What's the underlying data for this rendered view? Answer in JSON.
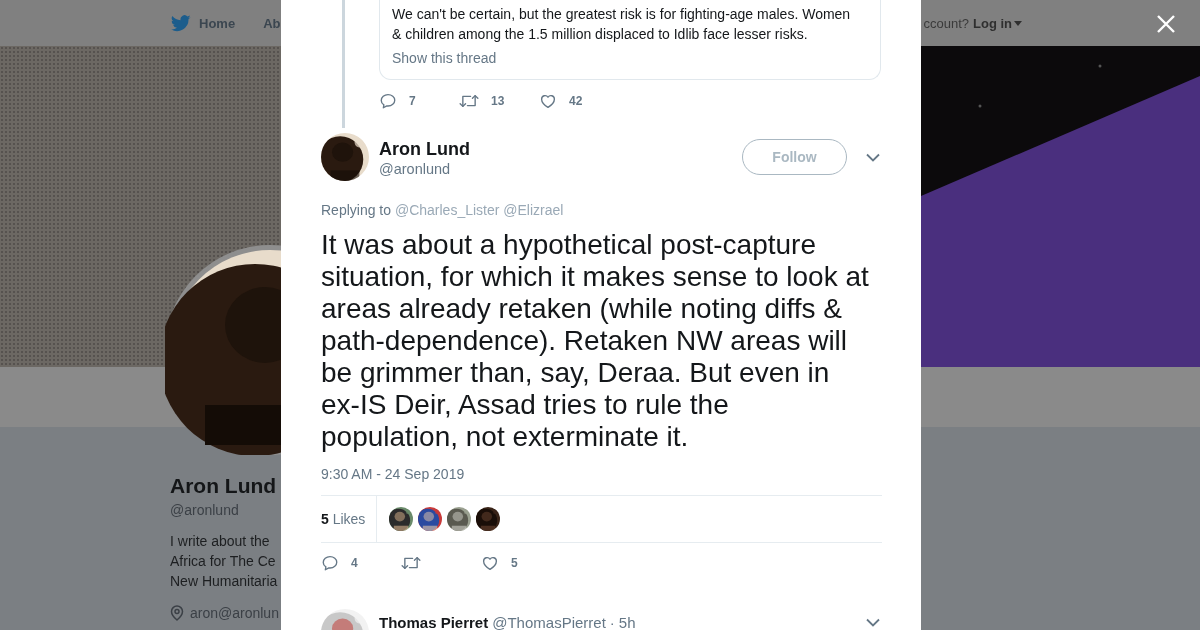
{
  "background_page": {
    "nav": {
      "home": "Home",
      "about": "Ab",
      "account_prompt": "ccount?",
      "login": "Log in"
    },
    "banner": {
      "kind": "picture"
    },
    "profile": {
      "avatar": {
        "kind": "picture"
      },
      "name": "Aron Lund",
      "handle": "@aronlund",
      "bio": [
        "I write about the",
        "Africa for The Ce",
        "New Humanitaria"
      ],
      "location": "aron@aronlun"
    }
  },
  "modal": {
    "quoted_tweet": {
      "text": "We can't be certain, but the greatest risk is for fighting-age males. Women & children among the 1.5 million displaced to Idlib face lesser risks.",
      "show_thread": "Show this thread",
      "reply_count": "7",
      "retweet_count": "13",
      "like_count": "42"
    },
    "tweet": {
      "avatar": {
        "kind": "picture"
      },
      "name": "Aron Lund",
      "handle": "@aronlund",
      "follow": "Follow",
      "replying_label": "Replying to",
      "replying_to": [
        "@Charles_Lister",
        "@Elizrael"
      ],
      "text": "It was about a hypothetical post-capture situation, for which it makes sense to look at areas already retaken (while noting diffs & path-dependence). Retaken NW areas will be grimmer than, say, Deraa. But even in ex-IS Deir, Assad tries to rule the population, not exterminate it.",
      "time": "9:30 AM - 24 Sep 2019",
      "likes_stat": "**5** Likes",
      "likers": [
        {
          "kind": "picture"
        },
        {
          "kind": "picture"
        },
        {
          "kind": "picture"
        },
        {
          "kind": "picture"
        }
      ],
      "reply_count": "4",
      "like_count": "5"
    },
    "replies": [
      {
        "avatar": {
          "kind": "picture"
        },
        "name": "Thomas Pierret",
        "handle": "@ThomasPierret",
        "separator": "·",
        "time": "5h"
      }
    ]
  }
}
